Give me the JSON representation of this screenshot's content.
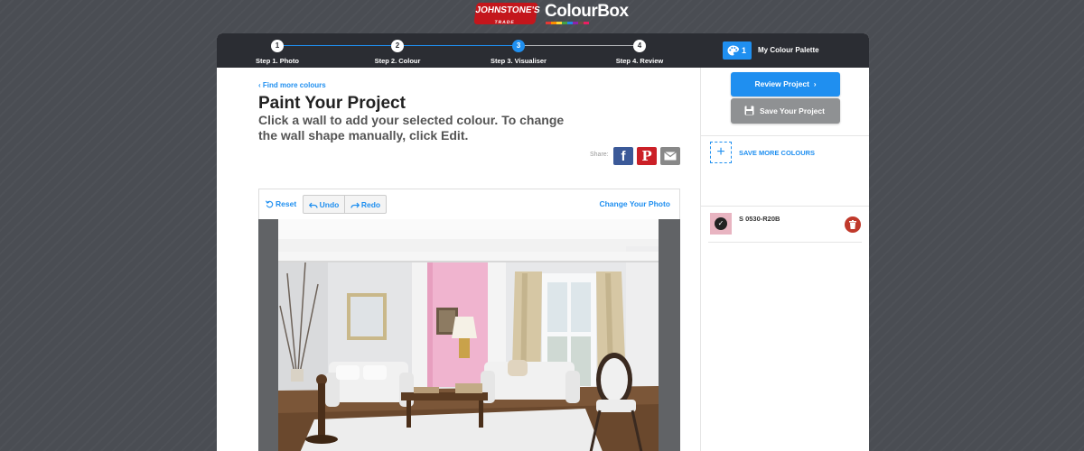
{
  "brand": {
    "johnstones": "JOHNSTONE'S",
    "johnstones_sub": "TRADE",
    "colourbox": "ColourBox",
    "swatch_colors": [
      "#e53935",
      "#fb8c00",
      "#fdd835",
      "#43a047",
      "#1e88e5",
      "#8e24aa",
      "#6d4c41",
      "#e91e63"
    ]
  },
  "steps": [
    {
      "number": "1",
      "label": "Step 1. Photo"
    },
    {
      "number": "2",
      "label": "Step 2. Colour"
    },
    {
      "number": "3",
      "label": "Step 3. Visualiser"
    },
    {
      "number": "4",
      "label": "Step 4. Review"
    }
  ],
  "current_step": 3,
  "palette": {
    "count": "1",
    "title": "My Colour Palette"
  },
  "content": {
    "find_more": "Find more colours",
    "title": "Paint Your Project",
    "instructions": "Click a wall to add your selected colour. To change the wall shape manually, click Edit.",
    "share_label": "Share:"
  },
  "toolbar": {
    "reset": "Reset",
    "undo": "Undo",
    "redo": "Redo",
    "change_photo": "Change Your Photo"
  },
  "sidebar": {
    "review_button": "Review Project",
    "save_button": "Save Your Project",
    "save_more": "SAVE MORE COLOURS",
    "colours": [
      {
        "name": "S 0530-R20B",
        "swatch": "#e8b4c1",
        "selected": true
      }
    ]
  },
  "colors": {
    "accent": "#1f8ff0",
    "dark_header": "#2b2d33",
    "background": "#4a4d53",
    "applied_wall": "#f0b4cf",
    "delete": "#c0392b"
  }
}
